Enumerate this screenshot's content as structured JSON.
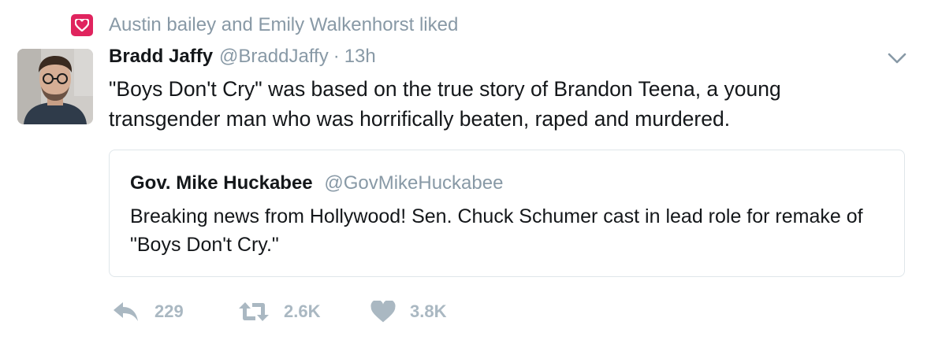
{
  "social_context": {
    "icon": "heart-icon",
    "text": "Austin bailey and Emily Walkenhorst liked",
    "color": "#e0245e"
  },
  "tweet": {
    "author_name": "Bradd Jaffy",
    "author_handle": "@BraddJaffy",
    "separator": "·",
    "timestamp": "13h",
    "text": "\"Boys Don't Cry\" was based on the true story of Brandon Teena, a young transgender man who was horrifically beaten, raped and murdered.",
    "menu_icon": "chevron-down-icon",
    "quoted": {
      "author_name": "Gov. Mike Huckabee",
      "author_handle": "@GovMikeHuckabee",
      "text": "Breaking news from Hollywood!  Sen. Chuck Schumer cast in lead role for remake of \"Boys Don't Cry.\""
    },
    "actions": {
      "reply": {
        "icon": "reply-icon",
        "count": "229"
      },
      "retweet": {
        "icon": "retweet-icon",
        "count": "2.6K"
      },
      "like": {
        "icon": "heart-icon",
        "count": "3.8K"
      }
    }
  },
  "colors": {
    "text": "#14171a",
    "secondary": "#8899a6",
    "action_icons": "#aab8c2",
    "border": "#dfe6ea"
  }
}
